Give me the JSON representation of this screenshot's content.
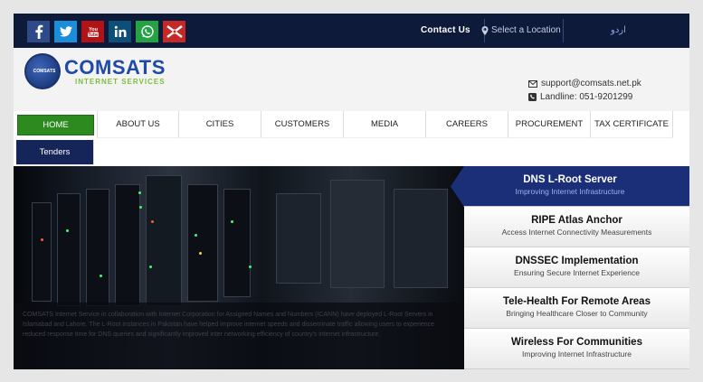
{
  "topbar": {
    "social": [
      {
        "name": "facebook-icon",
        "glyph": "f",
        "color": "#3b5998"
      },
      {
        "name": "twitter-icon",
        "glyph": "t",
        "color": "#1da1f2"
      },
      {
        "name": "youtube-icon",
        "glyph": "You Tube",
        "color": "#b31217"
      },
      {
        "name": "linkedin-icon",
        "glyph": "in",
        "color": "#0e4f7a"
      },
      {
        "name": "whatsapp-icon",
        "glyph": "w",
        "color": "#25a244"
      },
      {
        "name": "close-x-icon",
        "glyph": "x",
        "color": "#c62828"
      }
    ],
    "contact_label": "Contact Us",
    "location_label": "Select a Location",
    "urdu_label": "اردو"
  },
  "header": {
    "logo_text": "COMSATS",
    "logo_sub": "INTERNET SERVICES",
    "logo_badge": "COMSATS",
    "email": "support@comsats.net.pk",
    "landline": "Landline: 051-9201299"
  },
  "nav": {
    "items": [
      "HOME",
      "ABOUT US",
      "CITIES",
      "CUSTOMERS",
      "MEDIA",
      "CAREERS",
      "PROCUREMENT",
      "TAX CERTIFICATE"
    ],
    "tenders": "Tenders"
  },
  "hero": {
    "caption": "COMSATS Internet Service in collaboration with Internet Corporation for Assigned Names and Numbers (ICANN) have deployed L-Root Servers in Islamabad and Lahore. The L-Root instances in Pakistan have helped improve internet speeds and disseminate traffic allowing users to experience reduced response time for DNS queries and significantly improved inter networking efficiency of country's internet infrastructure."
  },
  "slides": [
    {
      "title": "DNS L-Root Server",
      "subtitle": "Improving Internet Infrastructure"
    },
    {
      "title": "RIPE Atlas Anchor",
      "subtitle": "Access Internet Connectivity Measurements"
    },
    {
      "title": "DNSSEC Implementation",
      "subtitle": "Ensuring Secure Internet Experience"
    },
    {
      "title": "Tele-Health For Remote Areas",
      "subtitle": "Bringing Healthcare Closer to Community"
    },
    {
      "title": "Wireless For Communities",
      "subtitle": "Improving Internet Infrastructure"
    }
  ],
  "colors": {
    "topbar": "#0e1a3a",
    "nav_home": "#2c8a1f",
    "tenders": "#15255a",
    "active_slide": "#1a2f78"
  }
}
